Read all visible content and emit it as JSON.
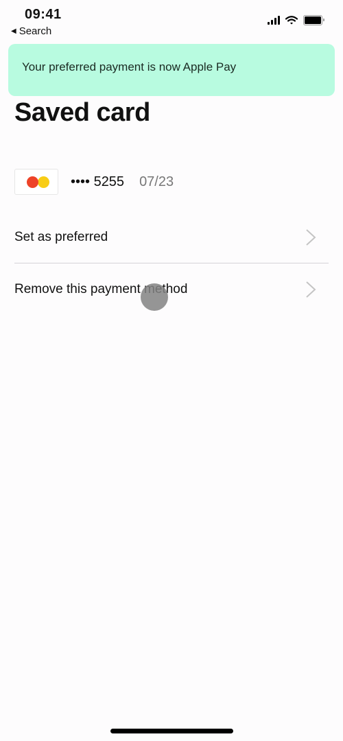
{
  "status_bar": {
    "time": "09:41",
    "back_label": "Search",
    "icons": [
      "cellular-signal-icon",
      "wifi-icon",
      "battery-icon"
    ]
  },
  "banner": {
    "message": "Your preferred payment is now Apple Pay",
    "color": "#b8fbe0"
  },
  "page": {
    "title": "Saved card"
  },
  "card": {
    "brand_icon": "mastercard-icon",
    "masked_number": "•••• 5255",
    "expiry": "07/23"
  },
  "actions": [
    {
      "label": "Set as preferred",
      "icon": "chevron-right-icon"
    },
    {
      "label": "Remove this payment method",
      "icon": "chevron-right-icon"
    }
  ]
}
